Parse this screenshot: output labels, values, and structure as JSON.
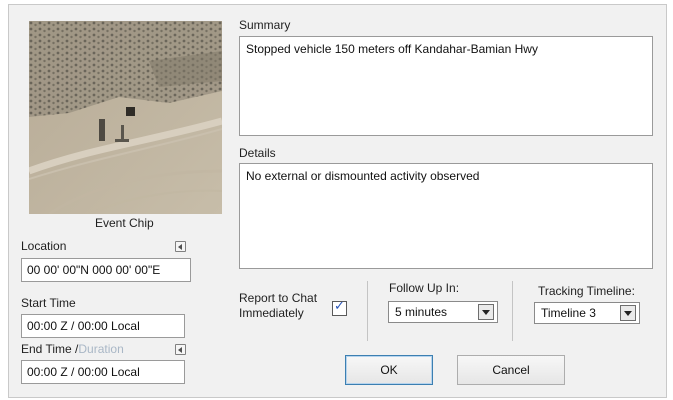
{
  "chip": {
    "caption": "Event Chip",
    "colors": {
      "sand": "#b4a996",
      "dark_rows": "#6f6a5e",
      "road": "#d9d1c3"
    }
  },
  "summary": {
    "label": "Summary",
    "value": "Stopped vehicle 150 meters off Kandahar-Bamian Hwy"
  },
  "details": {
    "label": "Details",
    "value": "No external or dismounted activity observed"
  },
  "location": {
    "label": "Location",
    "value": "00 00' 00\"N 000 00' 00\"E",
    "toggle_icon": "arrow-left-icon"
  },
  "start_time": {
    "label": "Start Time",
    "value": "00:00 Z / 00:00 Local"
  },
  "end_time": {
    "label_primary": "End Time",
    "label_separator": "/",
    "label_secondary": "Duration",
    "value": "00:00 Z / 00:00 Local",
    "toggle_icon": "arrow-left-icon"
  },
  "report_to_chat": {
    "label_line1": "Report to Chat",
    "label_line2": "Immediately",
    "checked": true
  },
  "follow_up": {
    "label": "Follow Up In:",
    "selected": "5 minutes"
  },
  "tracking": {
    "label": "Tracking Timeline:",
    "selected": "Timeline 3"
  },
  "buttons": {
    "ok": "OK",
    "cancel": "Cancel"
  },
  "colors": {
    "dialog_bg": "#f1f1f1",
    "checkbox_accent": "#2a55b8",
    "default_button_border": "#3c7fb1",
    "disabled_text": "#a9b7c6"
  }
}
